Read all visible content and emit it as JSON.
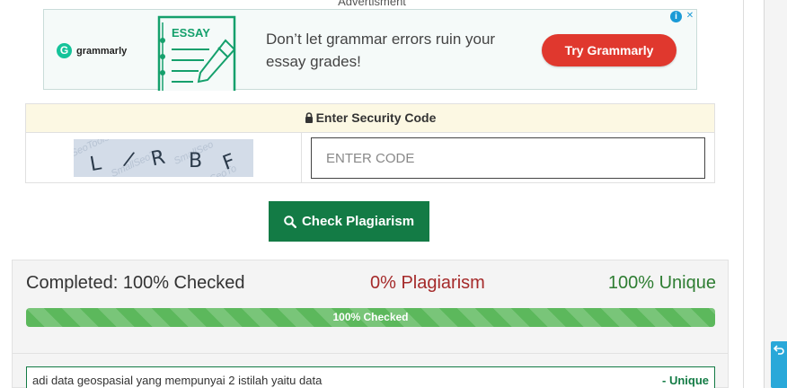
{
  "ad": {
    "label": "Advertisment",
    "brand": "grammarly",
    "brand_initial": "G",
    "graphic_word": "ESSAY",
    "message": "Don’t let grammar errors ruin your essay grades!",
    "cta_label": "Try Grammarly",
    "info_glyph": "i",
    "close_glyph": "✕"
  },
  "security": {
    "heading": "Enter Security Code",
    "captcha_text": "L/RBF",
    "code_placeholder": "ENTER CODE",
    "code_value": ""
  },
  "actions": {
    "check_label": "Check Plagiarism"
  },
  "results": {
    "completed": "Completed: 100% Checked",
    "plagiarism": "0% Plagiarism",
    "unique": "100% Unique",
    "progress_label": "100% Checked",
    "progress_fraction": 1.0
  },
  "sentences": [
    {
      "text": "adi data geospasial yang mempunyai 2 istilah yaitu data",
      "status": "- Unique"
    }
  ],
  "colors": {
    "primary_green": "#137b45",
    "plagiarism_red": "#a52a2a",
    "unique_green": "#2e7d32",
    "progress_green": "#5cb85c",
    "cta_red": "#e0382e",
    "notice_bg": "#fcf8e3"
  },
  "icons": {
    "lock": "lock-icon",
    "search": "search-icon",
    "info": "info-icon",
    "close": "close-icon",
    "scroll_top": "back-to-top-icon"
  }
}
